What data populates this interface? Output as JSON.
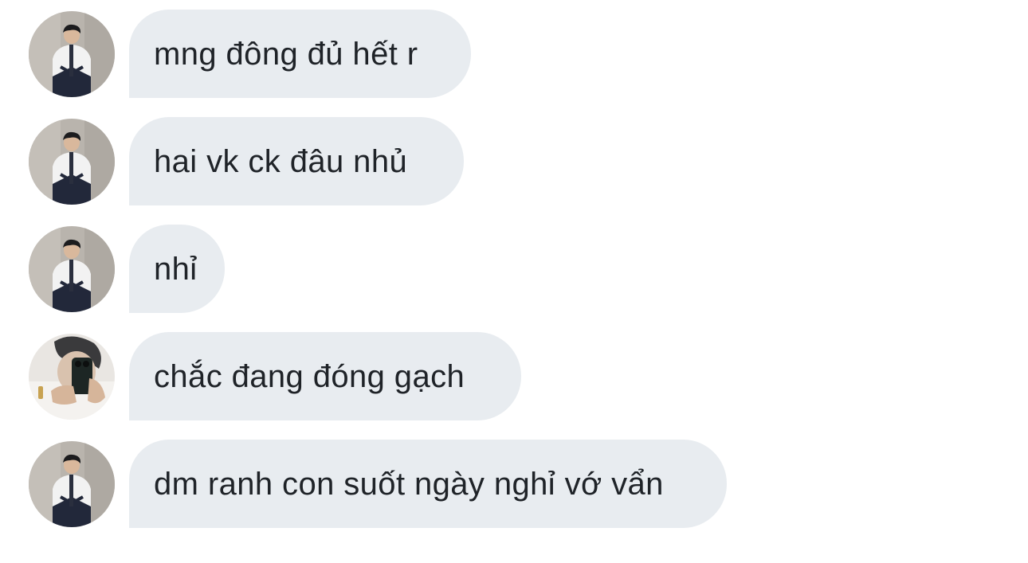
{
  "messages": [
    {
      "sender": "friend-a",
      "text": "mng đông đủ hết r"
    },
    {
      "sender": "friend-a",
      "text": "hai vk ck đâu nhủ"
    },
    {
      "sender": "friend-a",
      "text": "nhỉ"
    },
    {
      "sender": "friend-b",
      "text": "chắc đang đóng gạch"
    },
    {
      "sender": "friend-a",
      "text": "dm ranh con suốt ngày nghỉ vớ vẩn"
    }
  ],
  "colors": {
    "bubble_background": "#e8ecf0",
    "text": "#1f2328",
    "page_background": "#ffffff"
  }
}
